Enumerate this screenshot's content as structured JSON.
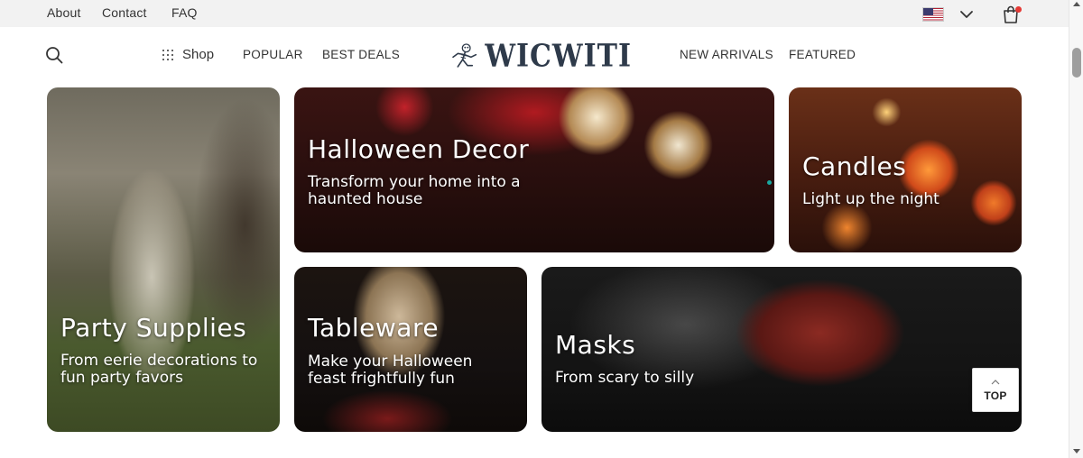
{
  "utility_bar": {
    "links": [
      "About",
      "Contact",
      "FAQ"
    ],
    "country_flag": "us-flag-icon",
    "cart_icon": "shopping-bag-icon",
    "cart_badge_color": "#e53935"
  },
  "main_nav": {
    "shop_label": "Shop",
    "left_links": [
      "POPULAR",
      "BEST DEALS"
    ],
    "right_links": [
      "NEW ARRIVALS",
      "FEATURED"
    ],
    "logo_text": "WICWITI"
  },
  "tiles": {
    "party": {
      "title": "Party Supplies",
      "subtitle": "From eerie decorations to fun party favors"
    },
    "decor": {
      "title": "Halloween Decor",
      "subtitle": "Transform your home into a haunted house"
    },
    "candles": {
      "title": "Candles",
      "subtitle": "Light up the night"
    },
    "tableware": {
      "title": "Tableware",
      "subtitle": "Make your Halloween feast frightfully fun"
    },
    "masks": {
      "title": "Masks",
      "subtitle": "From scary to silly"
    }
  },
  "back_to_top": {
    "label": "TOP"
  },
  "colors": {
    "accent_dot": "#19a8a0",
    "logo": "#2e3a4a"
  }
}
